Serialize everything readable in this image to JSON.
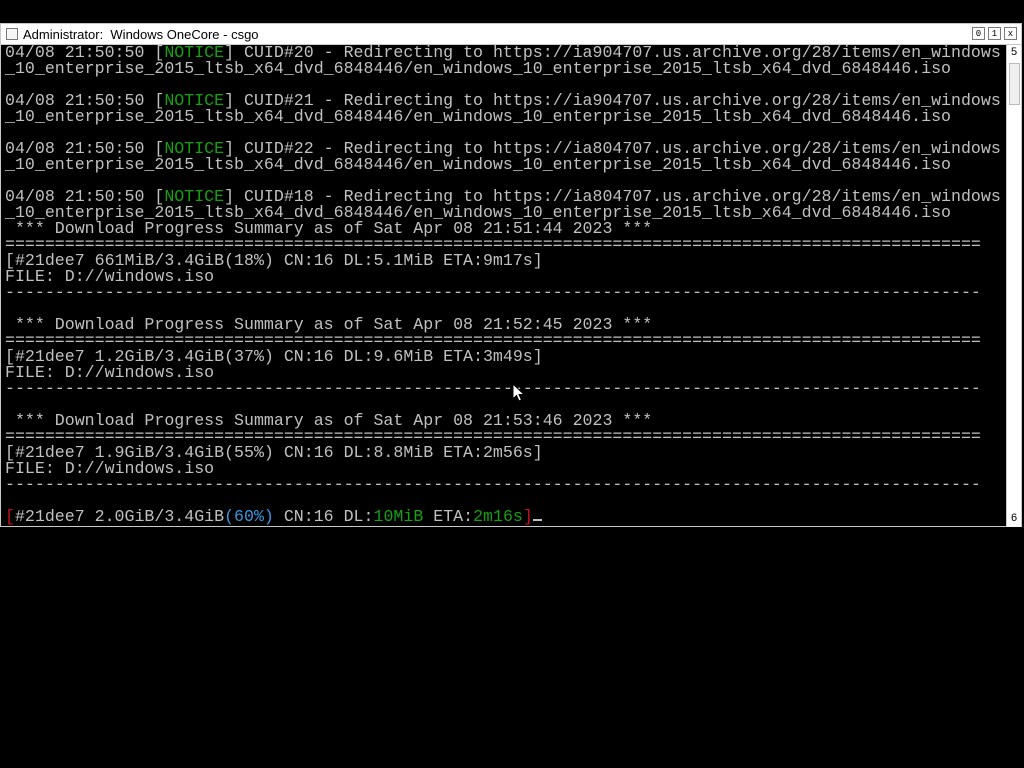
{
  "window": {
    "title": "Administrator:  Windows OneCore - csgo",
    "buttons": {
      "minimize": "0",
      "maximize": "1",
      "close": "x"
    }
  },
  "scrollbar": {
    "top_label": "5",
    "bottom_label": "6"
  },
  "console": {
    "lines": [
      {
        "segments": [
          {
            "t": "04/08 21:50:50 [",
            "c": ""
          },
          {
            "t": "NOTICE",
            "c": "green"
          },
          {
            "t": "] CUID#20 - Redirecting to https://ia904707.us.archive.org/28/items/en_windows",
            "c": ""
          }
        ]
      },
      {
        "segments": [
          {
            "t": "_10_enterprise_2015_ltsb_x64_dvd_6848446/en_windows_10_enterprise_2015_ltsb_x64_dvd_6848446.iso",
            "c": ""
          }
        ]
      },
      {
        "segments": [
          {
            "t": "",
            "c": ""
          }
        ]
      },
      {
        "segments": [
          {
            "t": "04/08 21:50:50 [",
            "c": ""
          },
          {
            "t": "NOTICE",
            "c": "green"
          },
          {
            "t": "] CUID#21 - Redirecting to https://ia904707.us.archive.org/28/items/en_windows",
            "c": ""
          }
        ]
      },
      {
        "segments": [
          {
            "t": "_10_enterprise_2015_ltsb_x64_dvd_6848446/en_windows_10_enterprise_2015_ltsb_x64_dvd_6848446.iso",
            "c": ""
          }
        ]
      },
      {
        "segments": [
          {
            "t": "",
            "c": ""
          }
        ]
      },
      {
        "segments": [
          {
            "t": "04/08 21:50:50 [",
            "c": ""
          },
          {
            "t": "NOTICE",
            "c": "green"
          },
          {
            "t": "] CUID#22 - Redirecting to https://ia804707.us.archive.org/28/items/en_windows",
            "c": ""
          }
        ]
      },
      {
        "segments": [
          {
            "t": "_10_enterprise_2015_ltsb_x64_dvd_6848446/en_windows_10_enterprise_2015_ltsb_x64_dvd_6848446.iso",
            "c": ""
          }
        ]
      },
      {
        "segments": [
          {
            "t": "",
            "c": ""
          }
        ]
      },
      {
        "segments": [
          {
            "t": "04/08 21:50:50 [",
            "c": ""
          },
          {
            "t": "NOTICE",
            "c": "green"
          },
          {
            "t": "] CUID#18 - Redirecting to https://ia804707.us.archive.org/28/items/en_windows",
            "c": ""
          }
        ]
      },
      {
        "segments": [
          {
            "t": "_10_enterprise_2015_ltsb_x64_dvd_6848446/en_windows_10_enterprise_2015_ltsb_x64_dvd_6848446.iso",
            "c": ""
          }
        ]
      },
      {
        "segments": [
          {
            "t": " *** Download Progress Summary as of Sat Apr 08 21:51:44 2023 ***",
            "c": ""
          }
        ]
      },
      {
        "segments": [
          {
            "t": "==================================================================================================",
            "c": ""
          }
        ]
      },
      {
        "segments": [
          {
            "t": "[#21dee7 661MiB/3.4GiB(18%) CN:16 DL:5.1MiB ETA:9m17s]",
            "c": ""
          }
        ]
      },
      {
        "segments": [
          {
            "t": "FILE: D://windows.iso",
            "c": ""
          }
        ]
      },
      {
        "segments": [
          {
            "t": "--------------------------------------------------------------------------------------------------",
            "c": ""
          }
        ]
      },
      {
        "segments": [
          {
            "t": "",
            "c": ""
          }
        ]
      },
      {
        "segments": [
          {
            "t": " *** Download Progress Summary as of Sat Apr 08 21:52:45 2023 ***",
            "c": ""
          }
        ]
      },
      {
        "segments": [
          {
            "t": "==================================================================================================",
            "c": ""
          }
        ]
      },
      {
        "segments": [
          {
            "t": "[#21dee7 1.2GiB/3.4GiB(37%) CN:16 DL:9.6MiB ETA:3m49s]",
            "c": ""
          }
        ]
      },
      {
        "segments": [
          {
            "t": "FILE: D://windows.iso",
            "c": ""
          }
        ]
      },
      {
        "segments": [
          {
            "t": "--------------------------------------------------------------------------------------------------",
            "c": ""
          }
        ]
      },
      {
        "segments": [
          {
            "t": "",
            "c": ""
          }
        ]
      },
      {
        "segments": [
          {
            "t": " *** Download Progress Summary as of Sat Apr 08 21:53:46 2023 ***",
            "c": ""
          }
        ]
      },
      {
        "segments": [
          {
            "t": "==================================================================================================",
            "c": ""
          }
        ]
      },
      {
        "segments": [
          {
            "t": "[#21dee7 1.9GiB/3.4GiB(55%) CN:16 DL:8.8MiB ETA:2m56s]",
            "c": ""
          }
        ]
      },
      {
        "segments": [
          {
            "t": "FILE: D://windows.iso",
            "c": ""
          }
        ]
      },
      {
        "segments": [
          {
            "t": "--------------------------------------------------------------------------------------------------",
            "c": ""
          }
        ]
      },
      {
        "segments": [
          {
            "t": "",
            "c": ""
          }
        ]
      },
      {
        "segments": [
          {
            "t": "[",
            "c": "red"
          },
          {
            "t": "#21dee7 2.0GiB/3.4GiB",
            "c": ""
          },
          {
            "t": "(60%)",
            "c": "cyan"
          },
          {
            "t": " CN:16 DL:",
            "c": ""
          },
          {
            "t": "10MiB",
            "c": "green"
          },
          {
            "t": " ETA:",
            "c": ""
          },
          {
            "t": "2m16s",
            "c": "green"
          },
          {
            "t": "]",
            "c": "red"
          }
        ],
        "cursor": true
      }
    ]
  },
  "colors": {
    "notice": "#13a10e",
    "text": "#c0c0c0",
    "bracket": "#c50f1f",
    "percent": "#3a96dd"
  }
}
